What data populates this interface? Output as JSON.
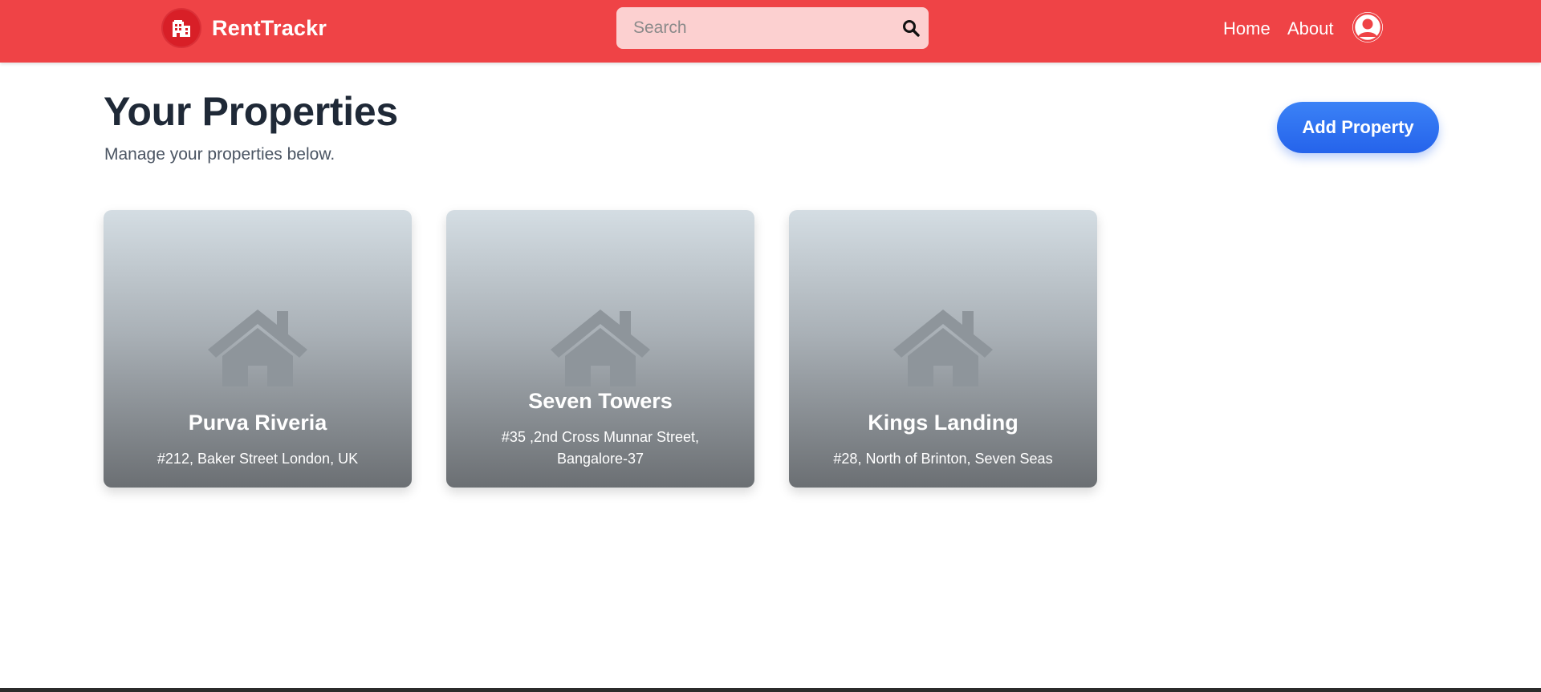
{
  "header": {
    "brand": "RentTrackr",
    "search_placeholder": "Search",
    "nav": {
      "home": "Home",
      "about": "About"
    }
  },
  "main": {
    "title": "Your Properties",
    "subtitle": "Manage your properties below.",
    "add_button": "Add Property"
  },
  "properties": [
    {
      "name": "Purva Riveria",
      "address": "#212, Baker Street London, UK"
    },
    {
      "name": "Seven Towers",
      "address": "#35 ,2nd Cross Munnar Street, Bangalore-37"
    },
    {
      "name": "Kings Landing",
      "address": "#28, North of Brinton, Seven Seas"
    }
  ],
  "icons": {
    "brand_logo": "building-icon",
    "search": "search-icon",
    "avatar": "user-avatar-icon",
    "property": "house-icon"
  },
  "colors": {
    "header_bg": "#ef4346",
    "accent_button": "#2563eb",
    "search_bg": "#fcd0d0",
    "title": "#1f2937"
  }
}
